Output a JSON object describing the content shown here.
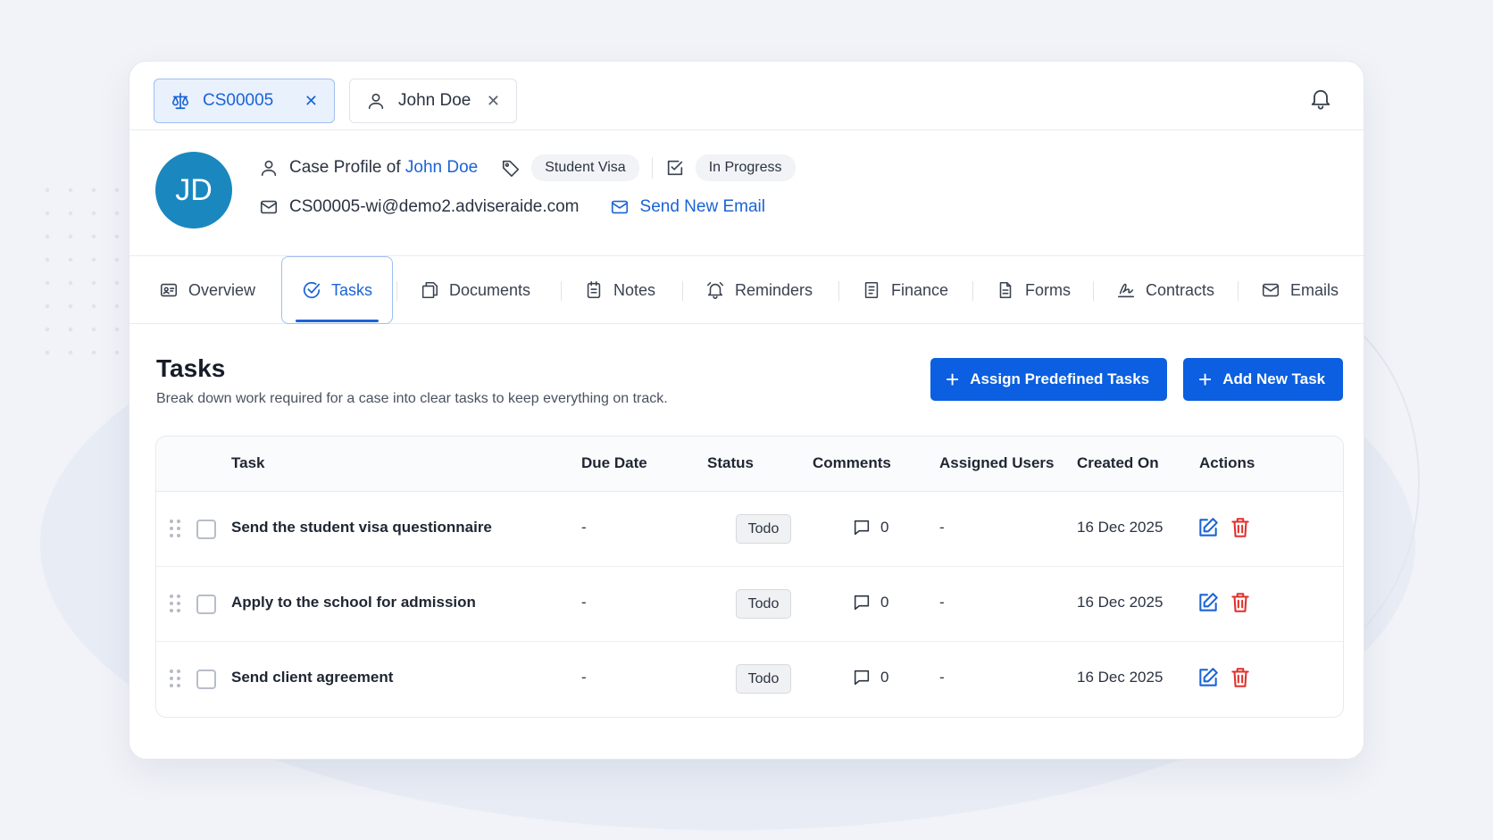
{
  "case_tabs": [
    {
      "label": "CS00005",
      "icon": "scale-icon",
      "active": true
    },
    {
      "label": "John Doe",
      "icon": "user-icon",
      "active": false
    }
  ],
  "profile": {
    "initials": "JD",
    "prefix": "Case Profile of ",
    "client_name": "John Doe",
    "visa_type": "Student Visa",
    "status": "In Progress",
    "email": "CS00005-wi@demo2.adviseraide.com",
    "send_email_label": "Send New Email"
  },
  "nav_tabs": [
    {
      "label": "Overview",
      "icon": "id-card-icon"
    },
    {
      "label": "Tasks",
      "icon": "check-circle-icon"
    },
    {
      "label": "Documents",
      "icon": "documents-icon"
    },
    {
      "label": "Notes",
      "icon": "notes-icon"
    },
    {
      "label": "Reminders",
      "icon": "bell-icon"
    },
    {
      "label": "Finance",
      "icon": "receipt-icon"
    },
    {
      "label": "Forms",
      "icon": "form-icon"
    },
    {
      "label": "Contracts",
      "icon": "signature-icon"
    },
    {
      "label": "Emails",
      "icon": "mail-icon"
    }
  ],
  "tasks": {
    "title": "Tasks",
    "subtitle": "Break down work required for a case into clear tasks to keep everything on track.",
    "assign_label": "Assign Predefined Tasks",
    "add_label": "Add New Task",
    "columns": [
      "Task",
      "Due Date",
      "Status",
      "Comments",
      "Assigned Users",
      "Created On",
      "Actions"
    ],
    "rows": [
      {
        "task": "Send the student visa questionnaire",
        "due": "-",
        "status": "Todo",
        "comments": "0",
        "assigned": "-",
        "created": "16 Dec 2025"
      },
      {
        "task": "Apply to the school for admission",
        "due": "-",
        "status": "Todo",
        "comments": "0",
        "assigned": "-",
        "created": "16 Dec 2025"
      },
      {
        "task": "Send client agreement",
        "due": "-",
        "status": "Todo",
        "comments": "0",
        "assigned": "-",
        "created": "16 Dec 2025"
      }
    ]
  },
  "colors": {
    "accent": "#0b5fe0",
    "link": "#1b63d6",
    "avatar": "#1a88bf",
    "delete": "#e0302c"
  }
}
